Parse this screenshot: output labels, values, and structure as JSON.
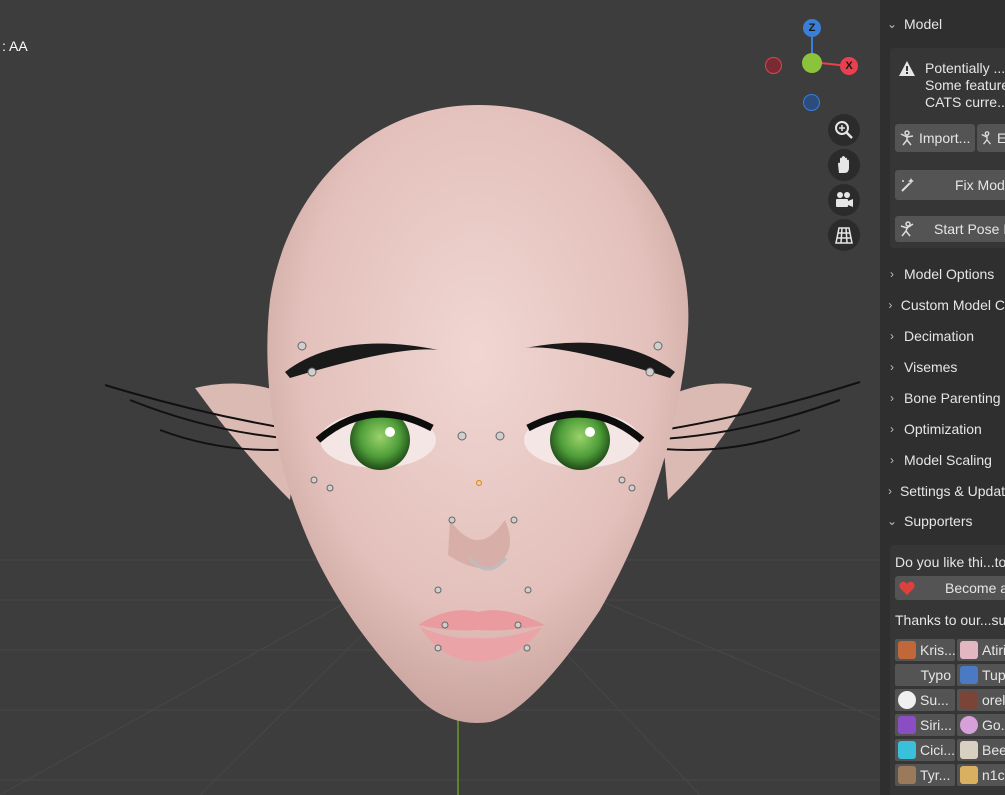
{
  "viewport": {
    "label": ": AA",
    "colors": {
      "background": "#3d3d3d",
      "skin": "#e8c7c2",
      "eye": "#4f9e3a",
      "x_axis": "#e8404f",
      "y_axis": "#8bc43a",
      "z_axis": "#3b7ed6"
    },
    "gizmo": {
      "x": "X",
      "z": "Z"
    },
    "nav_icons": [
      "zoom-icon",
      "hand-icon",
      "camera-icon",
      "grid-icon"
    ]
  },
  "sidebar": {
    "model_panel": {
      "title": "Model",
      "warning": {
        "icon": "warning-icon",
        "lines": [
          "Potentially ...",
          "Some feature",
          "CATS curre..."
        ]
      },
      "buttons": {
        "import": "Import...",
        "export": "E",
        "fix_model": "Fix Mod",
        "start_pose": "Start Pose I"
      }
    },
    "collapsed_panels": [
      "Model Options",
      "Custom Model C",
      "Decimation",
      "Visemes",
      "Bone Parenting",
      "Optimization",
      "Model Scaling",
      "Settings & Updat"
    ],
    "supporters_panel": {
      "title": "Supporters",
      "question": "Do you like thi...to",
      "become_button": "Become a",
      "thanks": "Thanks to our...sup",
      "supporters": [
        [
          "Kris...",
          "Atiri"
        ],
        [
          "Typo",
          "Tup"
        ],
        [
          "Su...",
          "orel"
        ],
        [
          "Siri...",
          "Go."
        ],
        [
          "Cici...",
          "Bee"
        ],
        [
          "Tyr...",
          "n1c"
        ]
      ]
    }
  }
}
